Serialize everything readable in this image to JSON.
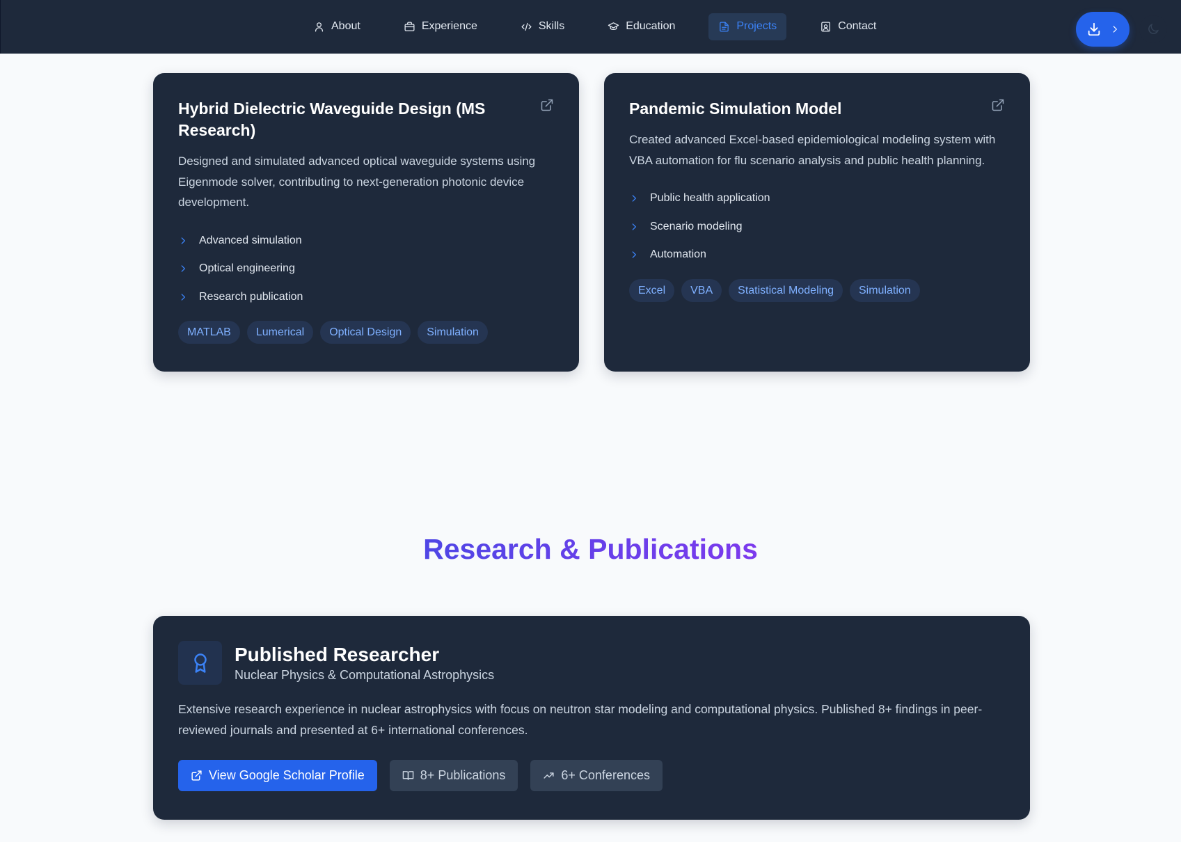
{
  "nav": {
    "items": [
      {
        "label": "About",
        "icon": "user-icon"
      },
      {
        "label": "Experience",
        "icon": "briefcase-icon"
      },
      {
        "label": "Skills",
        "icon": "code-icon"
      },
      {
        "label": "Education",
        "icon": "graduation-cap-icon"
      },
      {
        "label": "Projects",
        "icon": "file-text-icon",
        "active": true
      },
      {
        "label": "Contact",
        "icon": "contact-icon"
      }
    ],
    "download_icon": "download-icon",
    "chevron_icon": "chevron-right-icon",
    "theme_icon": "moon-icon",
    "accent_color": "#2563eb"
  },
  "projects": [
    {
      "title": "Hybrid Dielectric Waveguide Design (MS Research)",
      "description": "Designed and simulated advanced optical waveguide systems using Eigenmode solver, contributing to next-generation photonic device development.",
      "features": [
        "Advanced simulation",
        "Optical engineering",
        "Research publication"
      ],
      "tags": [
        "MATLAB",
        "Lumerical",
        "Optical Design",
        "Simulation"
      ]
    },
    {
      "title": "Pandemic Simulation Model",
      "description": "Created advanced Excel-based epidemiological modeling system with VBA automation for flu scenario analysis and public health planning.",
      "features": [
        "Public health application",
        "Scenario modeling",
        "Automation"
      ],
      "tags": [
        "Excel",
        "VBA",
        "Statistical Modeling",
        "Simulation"
      ]
    }
  ],
  "research": {
    "section_title": "Research & Publications",
    "title": "Published Researcher",
    "subtitle": "Nuclear Physics & Computational Astrophysics",
    "description": "Extensive research experience in nuclear astrophysics with focus on neutron star modeling and computational physics. Published 8+ findings in peer-reviewed journals and presented at 6+ international conferences.",
    "buttons": {
      "scholar": "View Google Scholar Profile",
      "publications": "8+ Publications",
      "conferences": "6+ Conferences"
    },
    "award_icon": "award-icon"
  },
  "colors": {
    "card_bg": "#1e293b",
    "page_bg": "#f8fafc",
    "tag_text": "#7fb0ff",
    "heading_gradient": [
      "#4f46e5",
      "#7c3aed"
    ]
  }
}
